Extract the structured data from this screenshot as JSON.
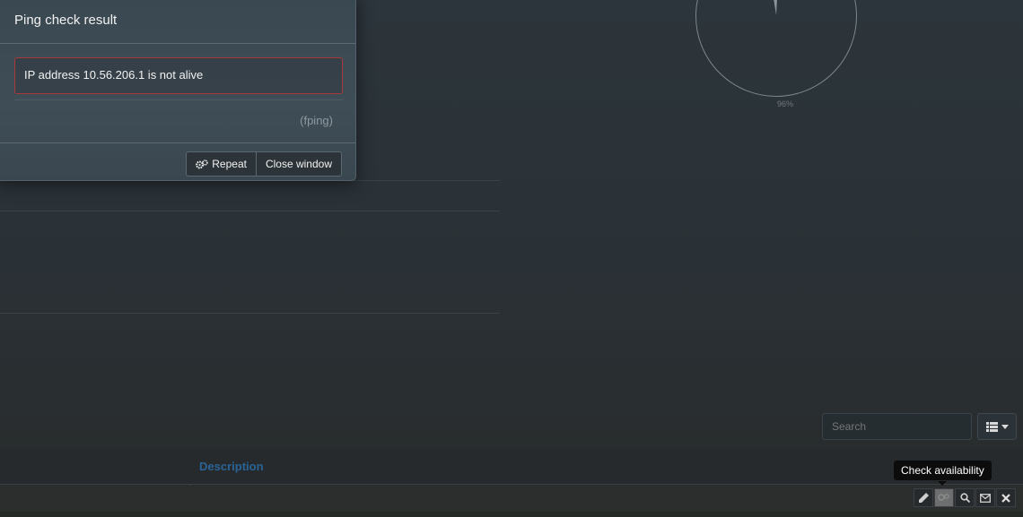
{
  "modal": {
    "title": "Ping check result",
    "message": "IP address 10.56.206.1 is not alive",
    "source": "(fping)",
    "repeat_label": "Repeat",
    "close_label": "Close window",
    "alert_color": "#a8393b"
  },
  "gauge": {
    "label": "96%"
  },
  "toolbar": {
    "search_placeholder": "Search",
    "columns_icon": "list-columns-icon"
  },
  "table": {
    "headers": [
      "Description"
    ],
    "header_color": "#2a6496"
  },
  "row_actions": {
    "icons": [
      "pencil-icon",
      "check-availability-icon",
      "search-icon",
      "envelope-icon",
      "close-icon"
    ],
    "tooltip": "Check availability"
  }
}
